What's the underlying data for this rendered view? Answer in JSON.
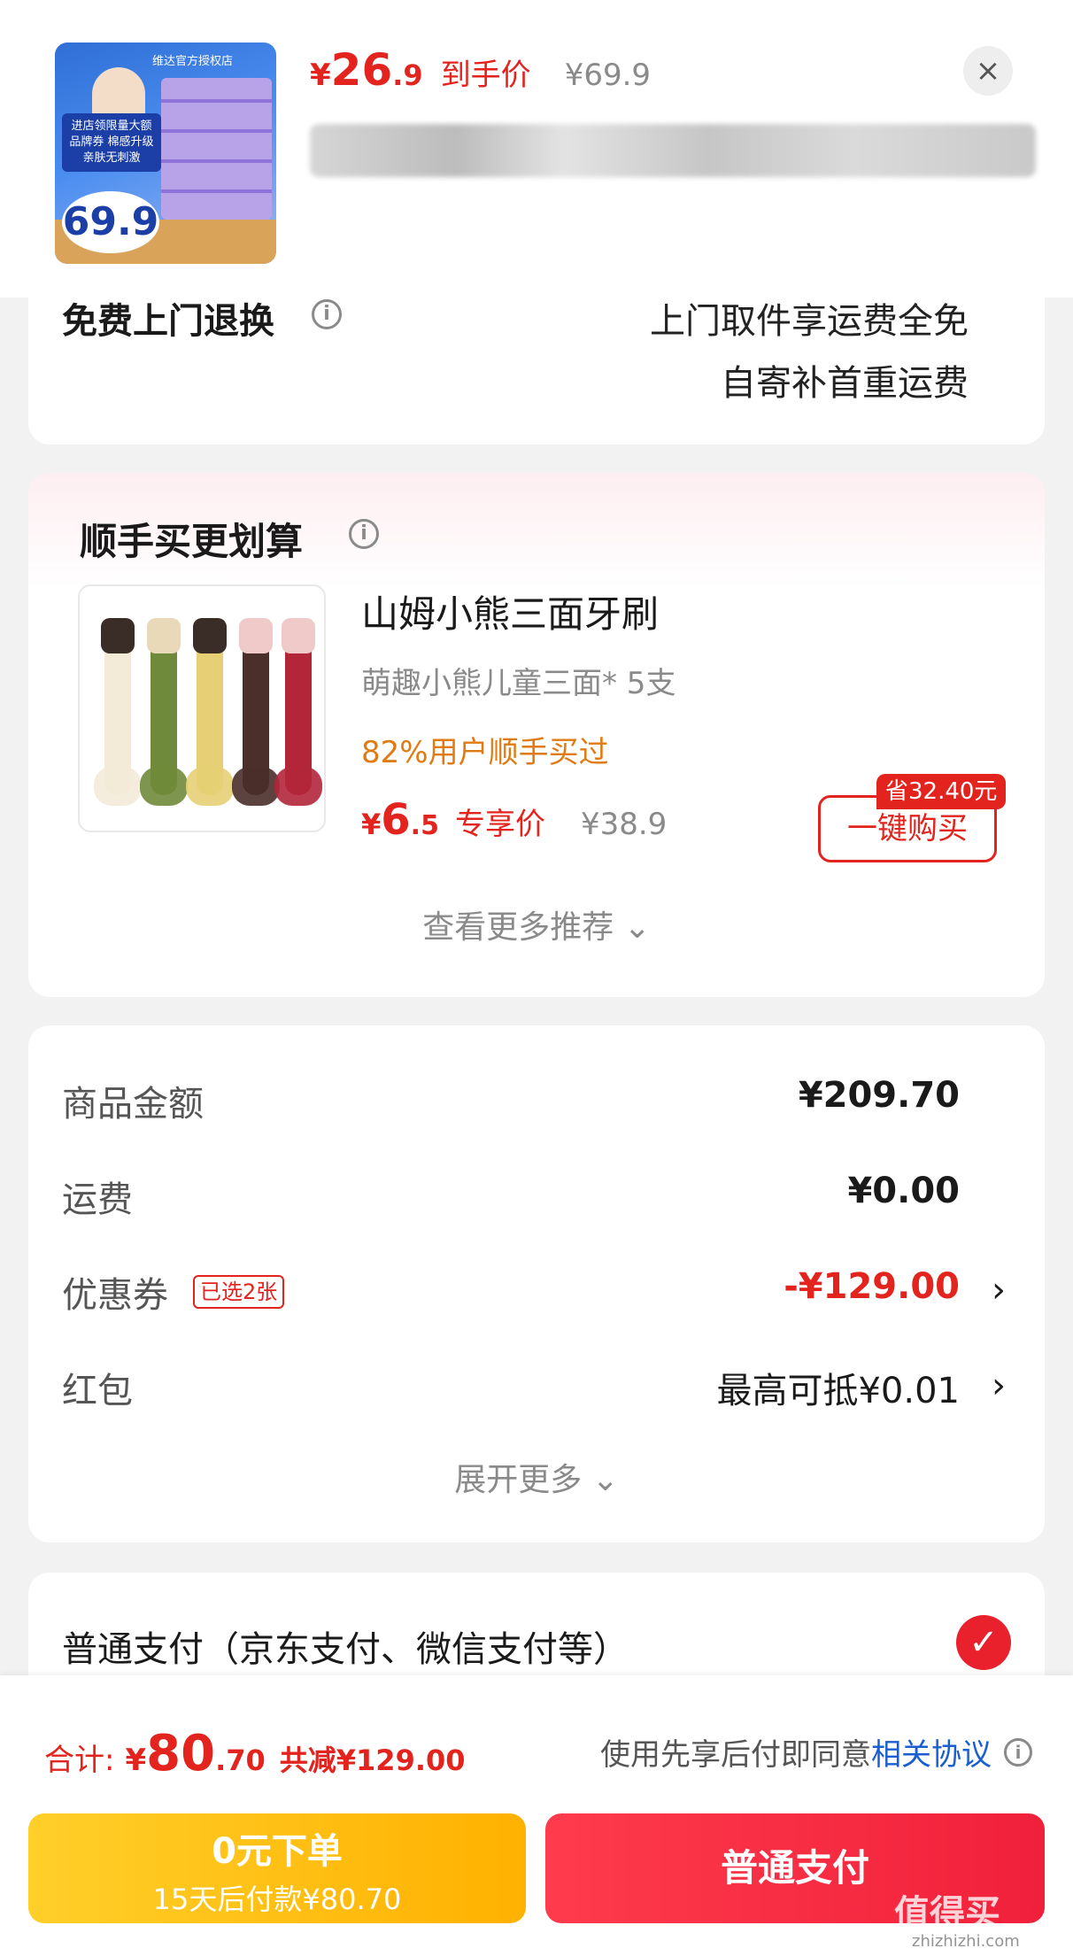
{
  "header": {
    "thumbnail": {
      "shop_tag": "维达官方授权店",
      "promo": "进店领限量大额品牌券 棉感升级 亲肤无刺激",
      "price_badge": "69.9"
    },
    "price_currency": "¥",
    "price_int": "26",
    "price_dec": ".9",
    "price_label": "到手价",
    "original_price": "¥69.9",
    "close_icon": "×"
  },
  "return_service": {
    "title": "免费上门退换",
    "info_icon": "i",
    "line1": "上门取件享运费全免",
    "line2": "自寄补首重运费"
  },
  "recommend": {
    "heading": "顺手买更划算",
    "info_icon": "i",
    "product": {
      "name": "山姆小熊三面牙刷",
      "desc": "萌趣小熊儿童三面* 5支",
      "bought": "82%用户顺手买过",
      "price_currency": "¥",
      "price_int": "6",
      "price_dec": ".5",
      "price_label": "专享价",
      "original_price": "¥38.9",
      "save_badge": "省32.40元",
      "buy_button": "一键购买",
      "brush_colors": [
        "#f3ead8",
        "#6f8a3a",
        "#e6cf74",
        "#4a2f2a",
        "#b3263a"
      ]
    },
    "more": "查看更多推荐 ⌄"
  },
  "summary": {
    "rows": [
      {
        "label": "商品金额",
        "value": "¥209.70"
      },
      {
        "label": "运费",
        "value": "¥0.00"
      },
      {
        "label": "优惠券",
        "tag": "已选2张",
        "value": "-¥129.00",
        "chevron": "›"
      },
      {
        "label": "红包",
        "value": "最高可抵¥0.01",
        "chevron": "›"
      }
    ],
    "expand": "展开更多 ⌄"
  },
  "payment_option": {
    "label": "普通支付（京东支付、微信支付等）",
    "check_icon": "✓"
  },
  "bottom_bar": {
    "total_label": "合计:",
    "total_currency": "¥",
    "total_int": "80",
    "total_dec": ".70",
    "total_reduce": "共减¥129.00",
    "agree_text": "使用先享后付即同意",
    "agree_link": "相关协议",
    "info_icon": "i",
    "later_main": "0元下单",
    "later_sub": "15天后付款¥80.70",
    "normal_pay": "普通支付"
  },
  "watermark": {
    "text": "值得买",
    "url": "zhizhizhi.com"
  },
  "colors": {
    "accent_red": "#e3231d",
    "link_blue": "#1a5fd0",
    "later_yellow": "#ffb100",
    "orange_text": "#e07b14"
  }
}
